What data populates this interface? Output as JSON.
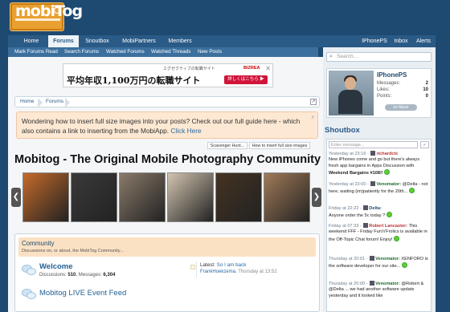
{
  "logo": {
    "text": "mobiTog"
  },
  "nav": {
    "tabs": [
      "Home",
      "Forums",
      "Snoutbox",
      "MobiPartners",
      "Members"
    ],
    "right": [
      "IPhonePS",
      "Inbox",
      "Alerts"
    ]
  },
  "subnav": [
    "Mark Forums Read",
    "Search Forums",
    "Watched Forums",
    "Watched Threads",
    "New Posts"
  ],
  "ad": {
    "top_text": "エグゼクティブの転職サイト",
    "brand": "BIZREA",
    "main_text": "平均年収1,100万円の転職サイト",
    "button": "詳しくはこちら ▶",
    "close": "✕"
  },
  "breadcrumb": [
    "Home",
    "Forums"
  ],
  "notice": {
    "text": "Wondering how to insert full size images into your posts? Check out our full guide here - which also contains a link to inserting from the MobiApp.",
    "link": "Click Here",
    "close": "x"
  },
  "mini_tabs": [
    "Scavenger Hunt...",
    "How to insert full size images"
  ],
  "page_title": "Mobitog - The Original Mobile Photography Community",
  "gallery": {
    "prev": "❮",
    "next": "❯",
    "photo_colors": [
      "#c56a2a",
      "#3a3a3a",
      "#8a7a6a",
      "#d2c4b0",
      "#443322",
      "#a07a58"
    ]
  },
  "category": {
    "title": "Community",
    "desc": "Discussions on, or about, the MobiTog Community..."
  },
  "forums": [
    {
      "title": "Welcome",
      "discussions_label": "Discussions:",
      "discussions": "510",
      "messages_label": "Messages:",
      "messages": "6,304"
    },
    {
      "title": "Mobitog LIVE Event Feed"
    }
  ],
  "latest": {
    "label": "Latest:",
    "thread": "So I am back",
    "user": "FrankHoekzema",
    "time": ", Thursday at 13:52"
  },
  "sidebar": {
    "search_placeholder": "Search...",
    "profile": {
      "name": "IPhonePS",
      "messages_label": "Messages:",
      "messages": "2",
      "likes_label": "Likes:",
      "likes": "10",
      "points_label": "Points:",
      "points": "0",
      "button": "no Muse"
    },
    "shoutbox_title": "Shoutbox",
    "shout_placeholder": "Enter message...",
    "shout_send": "✓",
    "shouts": [
      {
        "time": "Yesterday at 23:16 -",
        "user": "richardctc",
        "text": "New iPhones come and go but there's always fresh app bargains in Apps Discussion with",
        "extra": "Weekend Bargains #108!!"
      },
      {
        "time": "Yesterday at 23:00 -",
        "user": "Venomator:",
        "text": "@Delta - not here, waiting (im)patiently for the 20th..."
      },
      {
        "time": "Friday at 22:22 -",
        "user": "Delta:",
        "text": "Anyone order the 5c today ?"
      },
      {
        "time": "Friday at 07:33 -",
        "user": "Robert Lancaster:",
        "text": "This weekend FFF - Friday Fun'n'Frolics is available in the Off-Topic Chat forum! Enjoy!"
      },
      {
        "time": "Thursday at 20:01 -",
        "user": "Venomator:",
        "text": "XENFORO is the software developer for our site..."
      },
      {
        "time": "Thursday at 20:00 -",
        "user": "Venomator:",
        "text": "@Robert & @Delta ... we had another software update yesterday and it looked like"
      }
    ]
  }
}
